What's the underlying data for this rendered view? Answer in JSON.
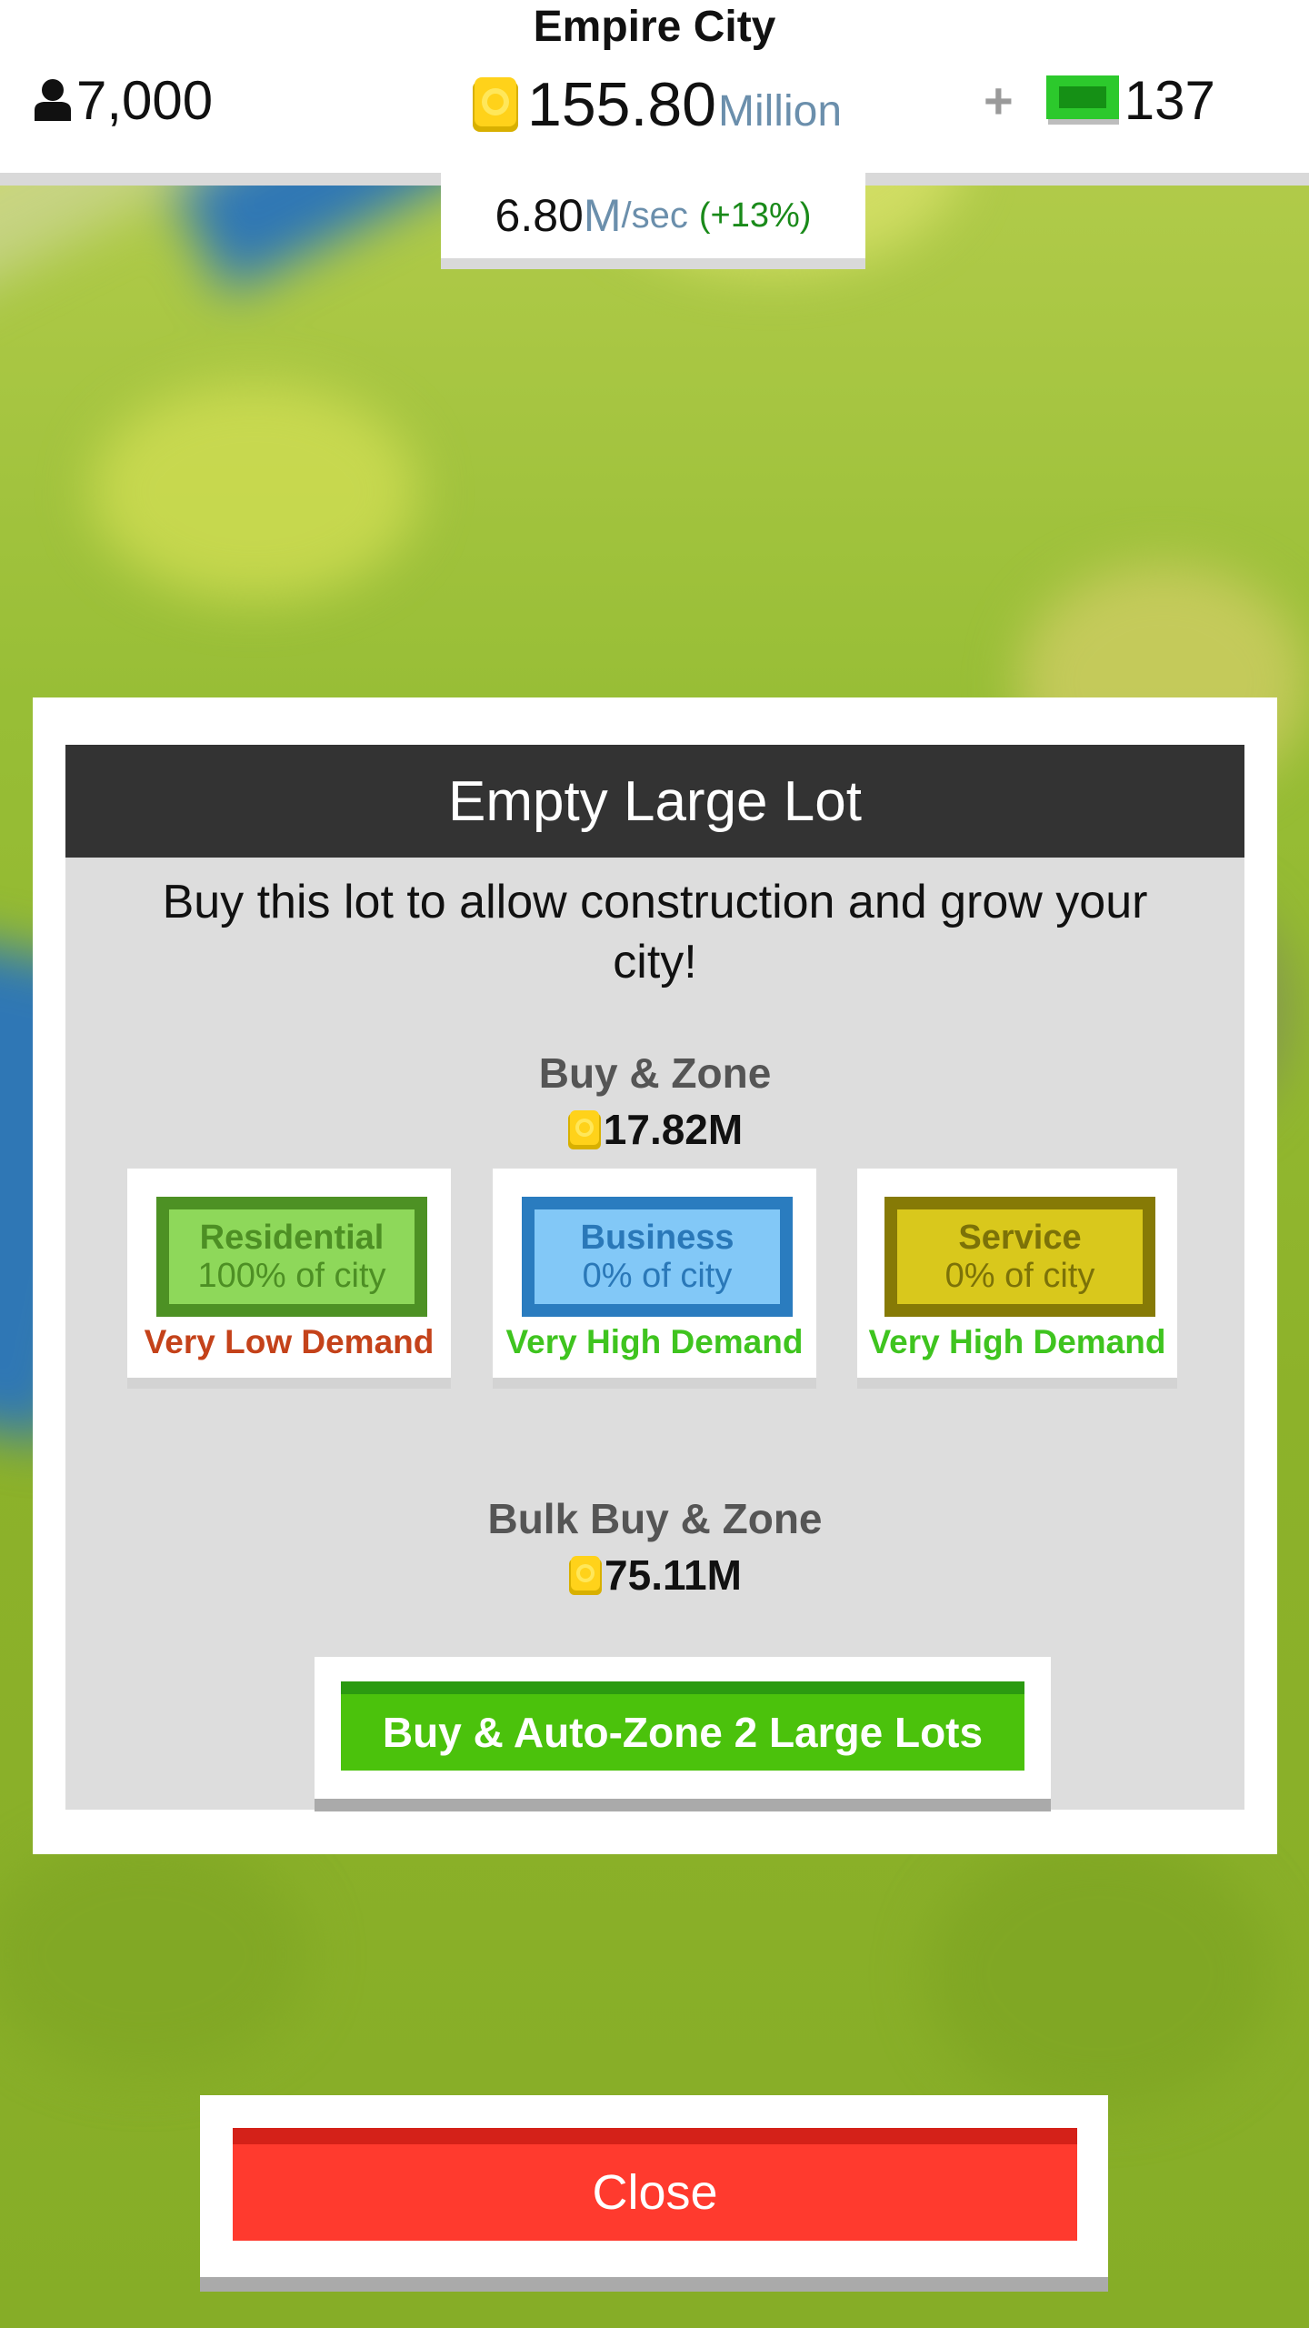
{
  "header": {
    "city_name": "Empire City",
    "population": "7,000",
    "money_value": "155.80",
    "money_unit": "Million",
    "plus_label": "+",
    "cash": "137",
    "income_value": "6.80",
    "income_unit": "M",
    "income_per": "/sec",
    "income_bonus": "(+13%)"
  },
  "dialog": {
    "title": "Empty Large Lot",
    "description": "Buy this lot to allow construction and grow your city!",
    "buy_zone_label": "Buy & Zone",
    "buy_zone_price": "17.82M",
    "zones": [
      {
        "name": "Residential",
        "share": "100% of city",
        "demand": "Very Low Demand",
        "fill_color": "#8ed85a",
        "border_color": "#4d9124",
        "text_color": "#4d8f24",
        "demand_color": "#c4421a"
      },
      {
        "name": "Business",
        "share": "0% of city",
        "demand": "Very High Demand",
        "fill_color": "#82c8f7",
        "border_color": "#2a7cbf",
        "text_color": "#2a78b8",
        "demand_color": "#3fc41f"
      },
      {
        "name": "Service",
        "share": "0% of city",
        "demand": "Very High Demand",
        "fill_color": "#d9c81c",
        "border_color": "#867a06",
        "text_color": "#7c7208",
        "demand_color": "#3fc41f"
      }
    ],
    "bulk_label": "Bulk Buy & Zone",
    "bulk_price": "75.11M",
    "bulk_button": "Buy & Auto-Zone 2 Large Lots"
  },
  "close_button": "Close",
  "icons": {
    "population": "person-icon",
    "money": "coin-icon",
    "cash": "cash-icon"
  },
  "colors": {
    "money_unit": "#6b8fac",
    "income_bonus": "#1a8a1a",
    "bulk_button": "#4bc20c",
    "close_button": "#ff3a2e",
    "dialog_header": "#333333"
  }
}
